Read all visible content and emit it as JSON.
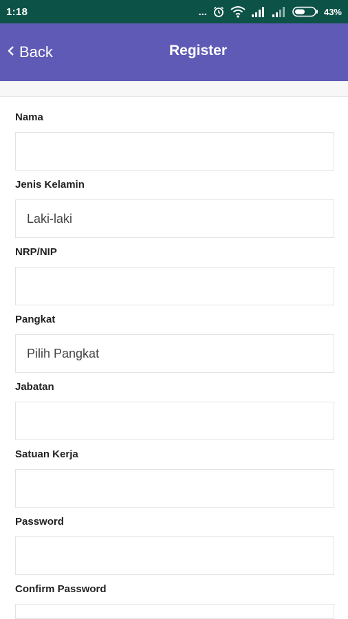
{
  "status_bar": {
    "time": "1:18",
    "dots": "...",
    "battery_percent": "43%",
    "icons": [
      "alarm-icon",
      "wifi-icon",
      "signal-icon",
      "signal-weak-icon",
      "battery-icon"
    ]
  },
  "header": {
    "back_label": "Back",
    "title": "Register",
    "background_color": "#5f5ab6"
  },
  "form": {
    "fields": [
      {
        "label": "Nama",
        "value": ""
      },
      {
        "label": "Jenis Kelamin",
        "value": "Laki-laki"
      },
      {
        "label": "NRP/NIP",
        "value": ""
      },
      {
        "label": "Pangkat",
        "value": "Pilih Pangkat"
      },
      {
        "label": "Jabatan",
        "value": ""
      },
      {
        "label": "Satuan Kerja",
        "value": ""
      },
      {
        "label": "Password",
        "value": ""
      },
      {
        "label": "Confirm Password",
        "value": ""
      }
    ]
  }
}
